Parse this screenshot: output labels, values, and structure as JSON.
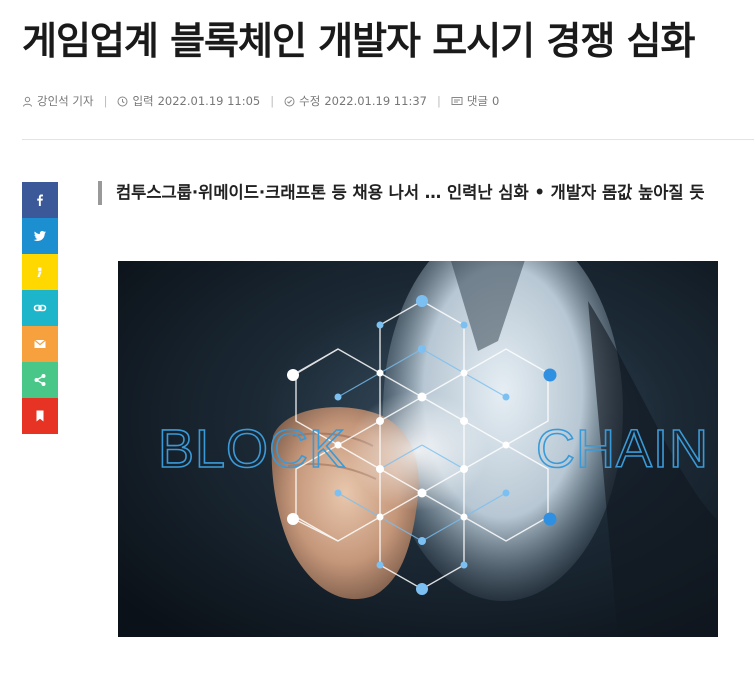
{
  "article": {
    "title": "게임업계 블록체인 개발자 모시기 경쟁 심화",
    "subtitle": "컴투스그룹·위메이드·크래프톤 등 채용 나서 … 인력난 심화 • 개발자 몸값 높아질 듯"
  },
  "meta": {
    "author": "강인석 기자",
    "published_label": "입력",
    "published": "2022.01.19 11:05",
    "modified_label": "수정",
    "modified": "2022.01.19 11:37",
    "comments_label": "댓글",
    "comments_count": "0",
    "icons": [
      "person-icon",
      "clock-icon",
      "check-circle-icon",
      "comment-icon"
    ]
  },
  "share": {
    "buttons": [
      {
        "name": "facebook",
        "color": "#3b5998"
      },
      {
        "name": "twitter",
        "color": "#1c8fd1"
      },
      {
        "name": "kakaostory",
        "color": "#ffd800"
      },
      {
        "name": "link-copy",
        "color": "#1cb5c9"
      },
      {
        "name": "email",
        "color": "#f6a13e"
      },
      {
        "name": "share",
        "color": "#48c788"
      },
      {
        "name": "bookmark",
        "color": "#e63323"
      }
    ]
  },
  "image": {
    "text_left": "BLOCK",
    "text_right": "CHAIN",
    "accent": "#3a9ad8"
  }
}
